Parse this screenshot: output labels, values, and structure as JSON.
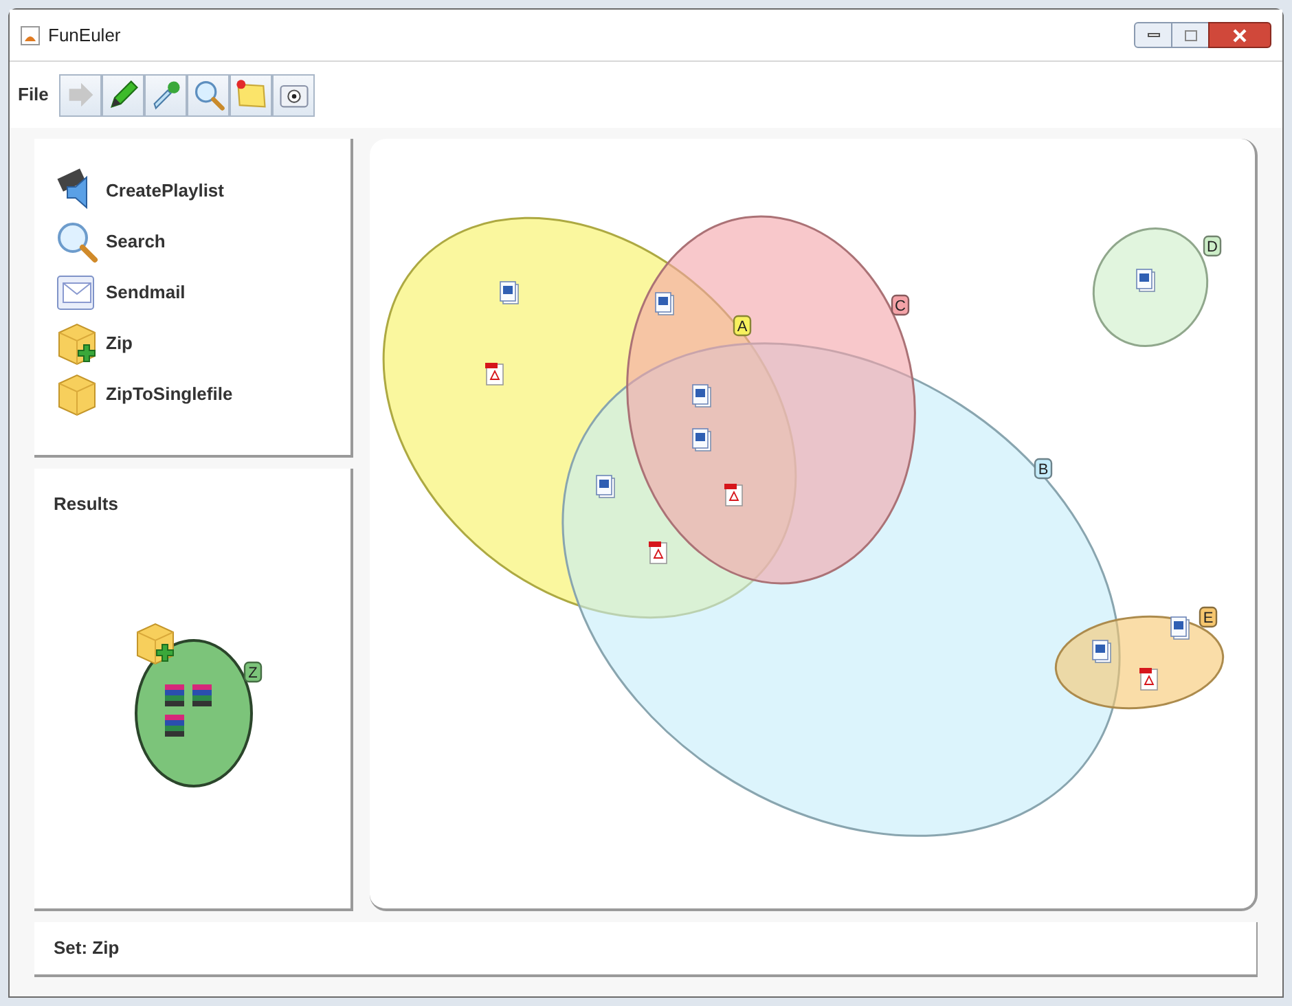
{
  "window": {
    "title": "FunEuler"
  },
  "menu": [
    "File"
  ],
  "operations": [
    {
      "label": "CreatePlaylist"
    },
    {
      "label": "Search"
    },
    {
      "label": "Sendmail"
    },
    {
      "label": "Zip"
    },
    {
      "label": "ZipToSinglefile"
    }
  ],
  "results": {
    "title": "Results",
    "set": {
      "label": "Z",
      "color": "#7cc47a"
    }
  },
  "diagram": {
    "sets": [
      {
        "label": "A",
        "color": "#f7f15e"
      },
      {
        "label": "B",
        "color": "#c4ecfa"
      },
      {
        "label": "C",
        "color": "#f4a3a8"
      },
      {
        "label": "D",
        "color": "#cdeec8"
      },
      {
        "label": "E",
        "color": "#f6c66e"
      }
    ],
    "files": [
      {
        "kind": "doc"
      },
      {
        "kind": "pdf"
      },
      {
        "kind": "doc"
      },
      {
        "kind": "doc"
      },
      {
        "kind": "doc"
      },
      {
        "kind": "doc"
      },
      {
        "kind": "pdf"
      },
      {
        "kind": "pdf"
      },
      {
        "kind": "doc"
      },
      {
        "kind": "doc"
      },
      {
        "kind": "doc"
      },
      {
        "kind": "pdf"
      }
    ]
  },
  "status_bar": "Set: Zip"
}
